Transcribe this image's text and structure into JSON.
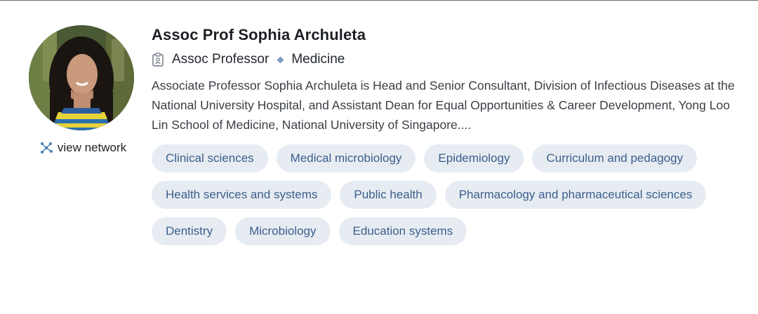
{
  "profile": {
    "name": "Assoc Prof Sophia Archuleta",
    "position": "Assoc Professor",
    "department": "Medicine",
    "bio": "Associate Professor Sophia Archuleta is Head and Senior Consultant, Division of Infectious Diseases at the National University Hospital, and Assistant Dean for Equal Opportunities & Career Development, Yong Loo Lin School of Medicine, National University of Singapore....",
    "view_network_label": "view network",
    "position_icon": "id-badge-icon",
    "network_icon": "network-icon"
  },
  "tags": [
    {
      "label": "Clinical sciences"
    },
    {
      "label": "Medical microbiology"
    },
    {
      "label": "Epidemiology"
    },
    {
      "label": "Curriculum and pedagogy"
    },
    {
      "label": "Health services and systems"
    },
    {
      "label": "Public health"
    },
    {
      "label": "Pharmacology and pharmaceutical sciences"
    },
    {
      "label": "Dentistry"
    },
    {
      "label": "Microbiology"
    },
    {
      "label": "Education systems"
    }
  ],
  "colors": {
    "tag_background": "#e7ecf2",
    "tag_text": "#3b5f8c",
    "separator_diamond": "#7f9cc0"
  }
}
